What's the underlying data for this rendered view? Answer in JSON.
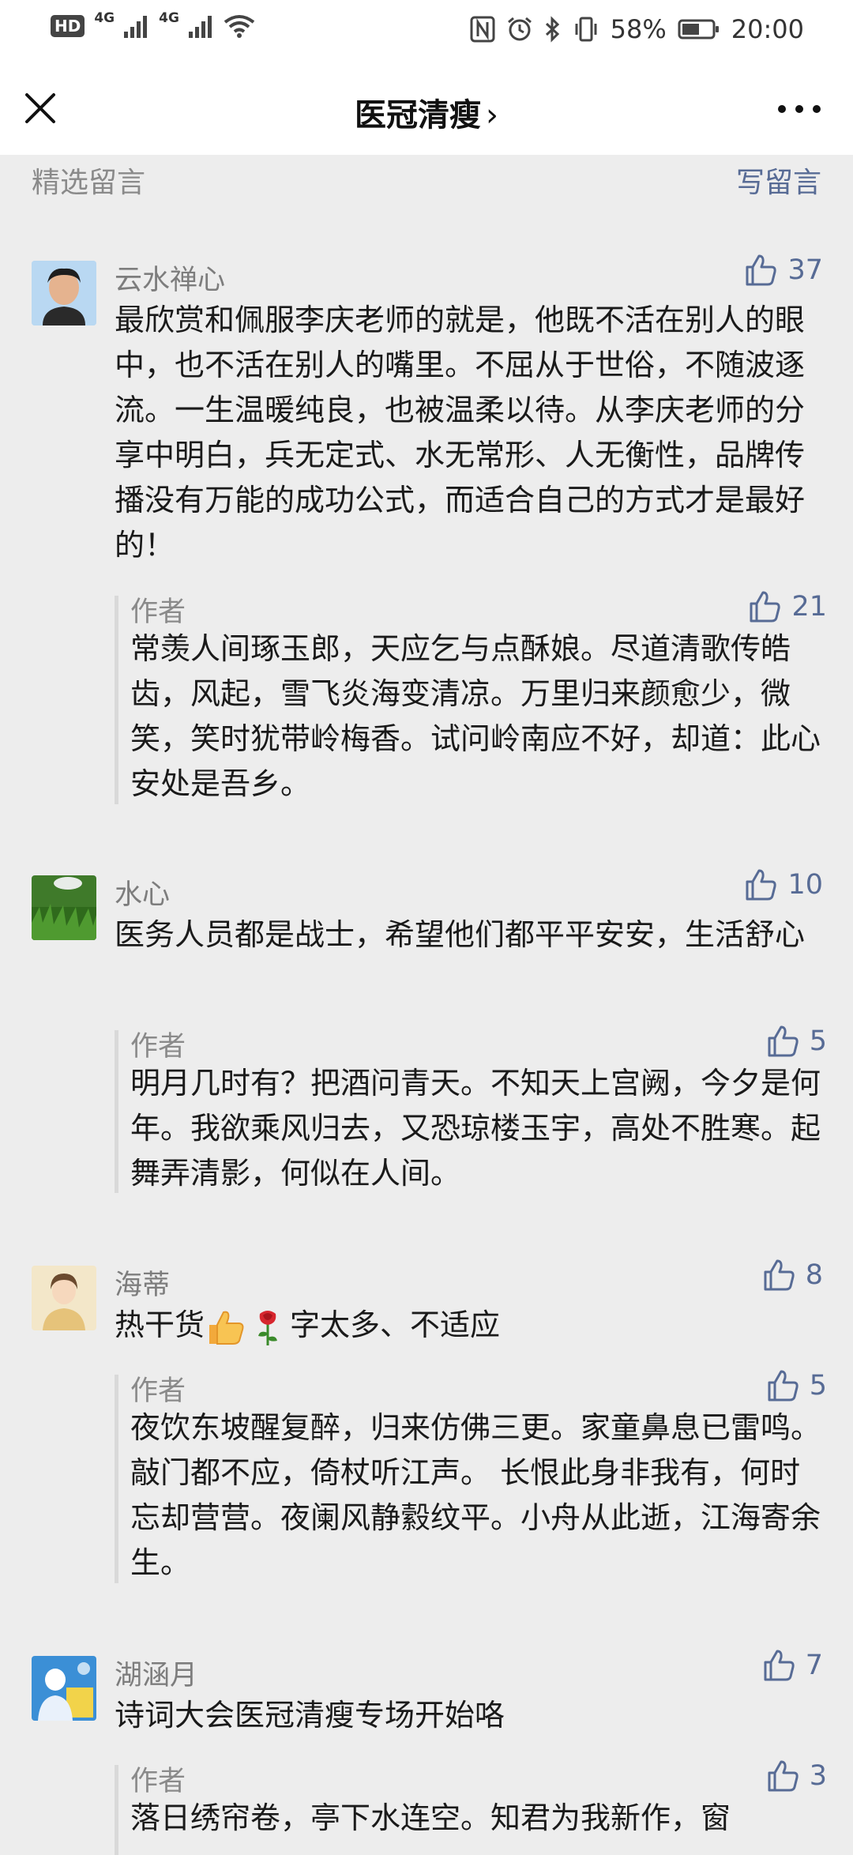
{
  "status_bar": {
    "hd": "HD",
    "net1": "4G",
    "net2": "4G",
    "battery": "58%",
    "time": "20:00",
    "icons": [
      "hd-icon",
      "signal-icon",
      "wifi-icon",
      "nfc-icon",
      "alarm-icon",
      "bluetooth-icon",
      "vibrate-icon",
      "battery-icon"
    ]
  },
  "nav": {
    "title": "医冠清瘦",
    "chevron": "›",
    "close_icon": "close-icon",
    "more_icon": "more-icon"
  },
  "section": {
    "title": "精选留言",
    "write_label": "写留言"
  },
  "comments": [
    {
      "name": "云水禅心",
      "likes": "37",
      "text": "最欣赏和佩服李庆老师的就是，他既不活在别人的眼中，也不活在别人的嘴里。不屈从于世俗，不随波逐流。一生温暖纯良，也被温柔以待。从李庆老师的分享中明白，兵无定式、水无常形、人无衡性，品牌传播没有万能的成功公式，而适合自己的方式才是最好的！",
      "reply": {
        "name": "作者",
        "likes": "21",
        "text": "常羡人间琢玉郎，天应乞与点酥娘。尽道清歌传皓齿，风起，雪飞炎海变清凉。万里归来颜愈少，微笑，笑时犹带岭梅香。试问岭南应不好，却道：此心安处是吾乡。"
      }
    },
    {
      "name": "水心",
      "likes": "10",
      "text": "医务人员都是战士，希望他们都平平安安，生活舒心",
      "reply": {
        "name": "作者",
        "likes": "5",
        "text": "明月几时有？把酒问青天。不知天上宫阙，今夕是何年。我欲乘风归去，又恐琼楼玉宇，高处不胜寒。起舞弄清影，何似在人间。"
      }
    },
    {
      "name": "海蒂",
      "likes": "8",
      "text_before": "热干货",
      "text_after": "字太多、不适应",
      "emoji": [
        "thumbs-up-emoji",
        "rose-emoji"
      ],
      "reply": {
        "name": "作者",
        "likes": "5",
        "text": "夜饮东坡醒复醉，归来仿佛三更。家童鼻息已雷鸣。敲门都不应，倚杖听江声。 长恨此身非我有，何时忘却营营。夜阑风静縠纹平。小舟从此逝，江海寄余生。"
      }
    },
    {
      "name": "湖涵月",
      "likes": "7",
      "text": "诗词大会医冠清瘦专场开始咯",
      "reply": {
        "name": "作者",
        "likes": "3",
        "text": "落日绣帘卷，亭下水连空。知君为我新作，窗"
      }
    }
  ],
  "colors": {
    "background": "#ededed",
    "link": "#576b95",
    "secondary_text": "#8a8a8a"
  }
}
